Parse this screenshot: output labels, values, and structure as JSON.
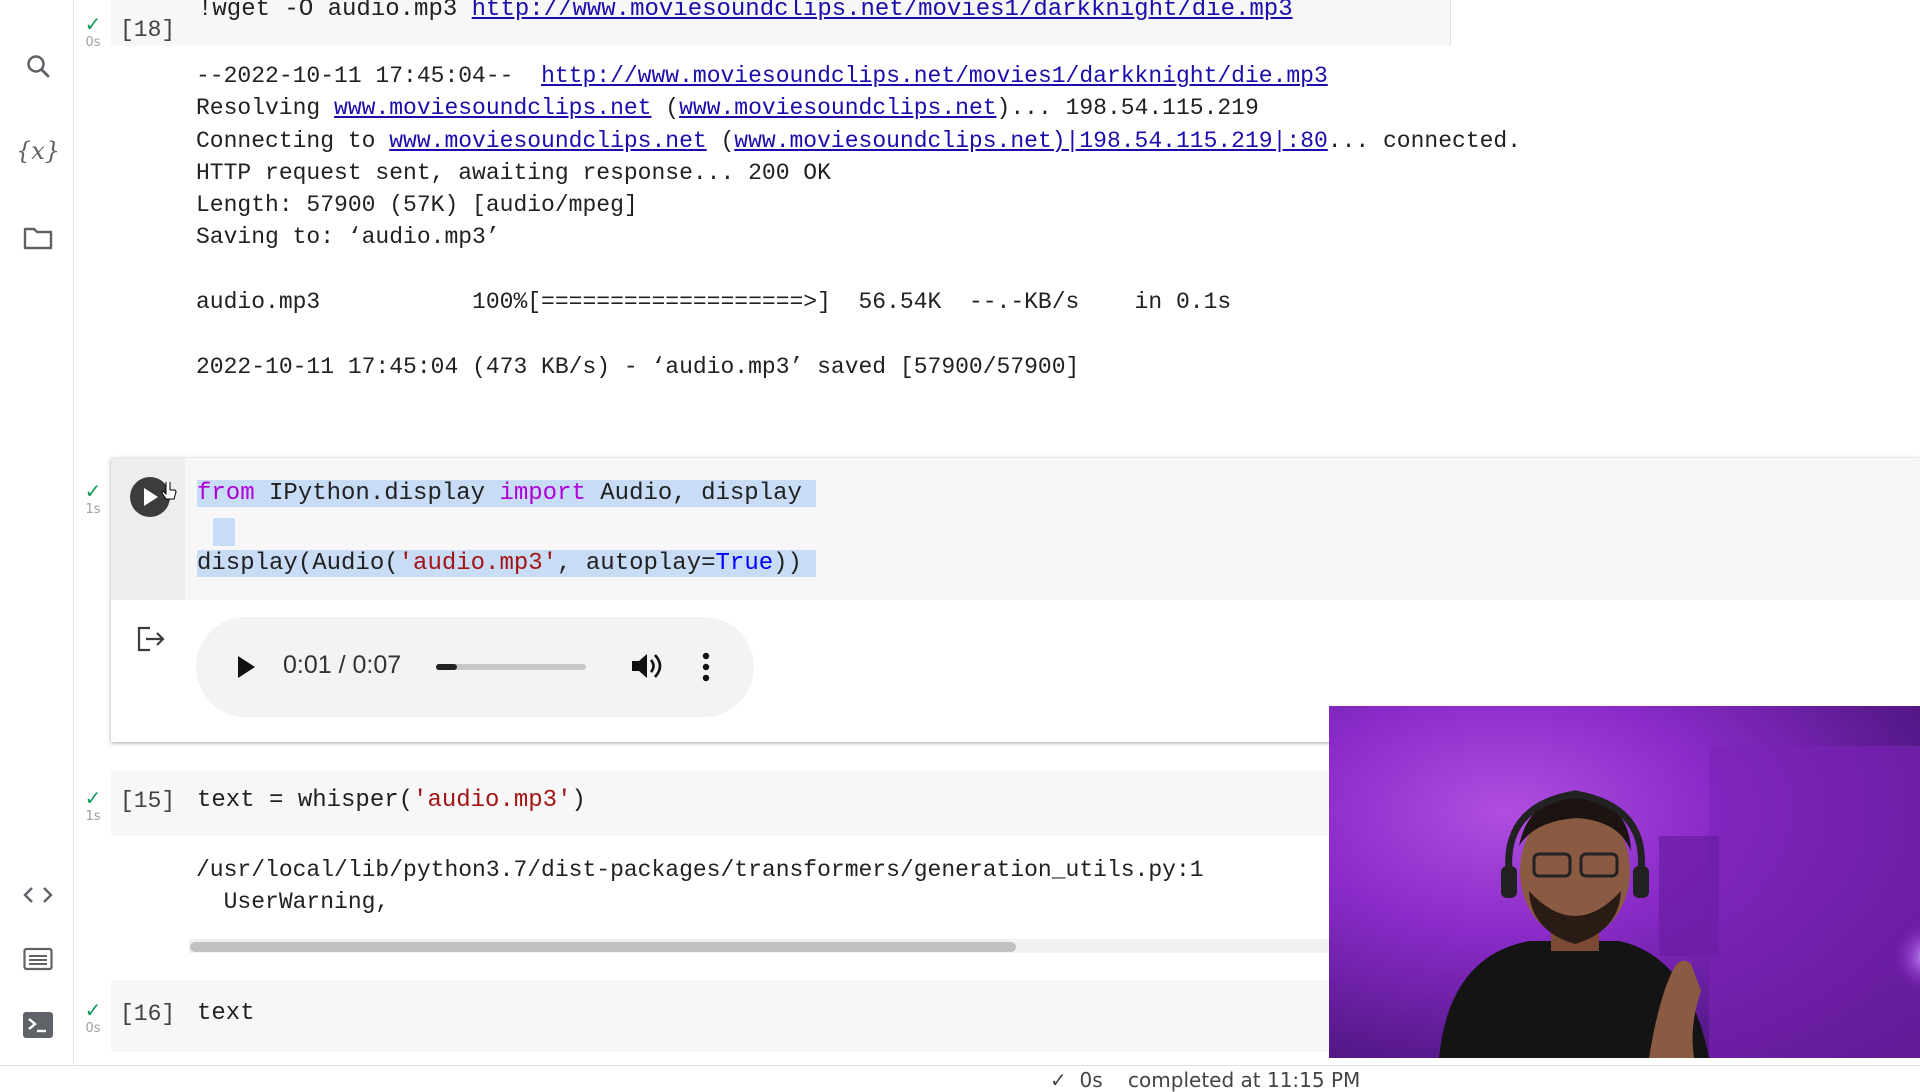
{
  "sidebar": {
    "icons": [
      "search-icon",
      "variables-icon",
      "folder-icon",
      "code-snippets-icon",
      "command-palette-icon",
      "terminal-icon"
    ]
  },
  "cell_wget": {
    "exec_count": "[18]",
    "duration": "0s",
    "command_prefix": "!wget -O audio.mp3 ",
    "command_url": "http://www.moviesoundclips.net/movies1/darkknight/die.mp3",
    "output": {
      "line1_prefix": "--2022-10-11 17:45:04--  ",
      "line1_url": "http://www.moviesoundclips.net/movies1/darkknight/die.mp3",
      "line2_prefix": "Resolving ",
      "line2_host": "www.moviesoundclips.net",
      "line2_open": " (",
      "line2_host2": "www.moviesoundclips.net",
      "line2_rest": ")... 198.54.115.219",
      "line3_prefix": "Connecting to ",
      "line3_host": "www.moviesoundclips.net",
      "line3_open": " (",
      "line3_host2": "www.moviesoundclips.net)|198.54.115.219|:80",
      "line3_rest": "... connected.",
      "line4": "HTTP request sent, awaiting response... 200 OK",
      "line5": "Length: 57900 (57K) [audio/mpeg]",
      "line6": "Saving to: ‘audio.mp3’",
      "line7": "audio.mp3           100%[===================>]  56.54K  --.-KB/s    in 0.1s",
      "line8": "2022-10-11 17:45:04 (473 KB/s) - ‘audio.mp3’ saved [57900/57900]"
    }
  },
  "cell_audio": {
    "duration": "1s",
    "line1": {
      "kw1": "from",
      "mod": " IPython.display ",
      "kw2": "import",
      "rest": " Audio, display"
    },
    "line2": {
      "fn": "display(Audio(",
      "str": "'audio.mp3'",
      "mid": ", autoplay=",
      "val": "True",
      "end": "))"
    },
    "player": {
      "time": "0:01 / 0:07",
      "progress": 0.14
    }
  },
  "cell_whisper": {
    "exec_count": "[15]",
    "duration": "1s",
    "code": {
      "pre": "text = whisper(",
      "str": "'audio.mp3'",
      "end": ")"
    },
    "output": {
      "line1": "/usr/local/lib/python3.7/dist-packages/transformers/generation_utils.py:1",
      "line2": "  UserWarning,"
    }
  },
  "cell_text": {
    "exec_count": "[16]",
    "duration": "0s",
    "code": "text"
  },
  "footer": {
    "status": "✓  0s    completed at 11:15 PM"
  }
}
